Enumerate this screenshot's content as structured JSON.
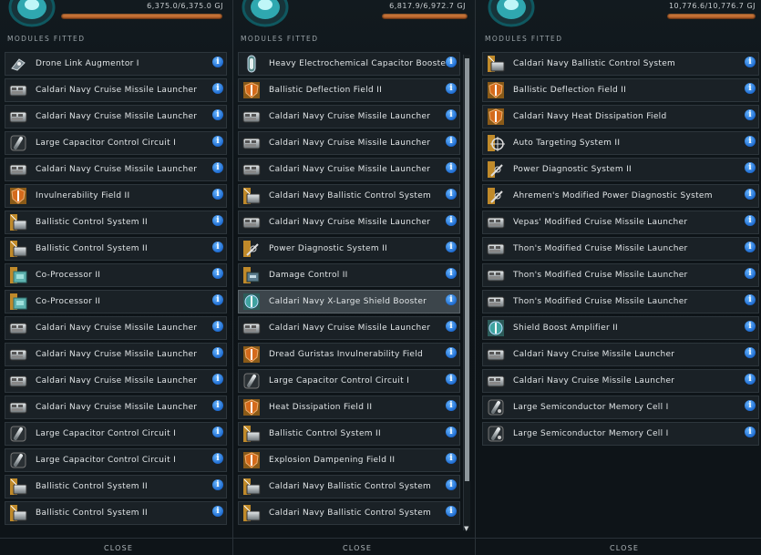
{
  "icons": {
    "drone-link-augmentor": "drone-link-icon",
    "cruise-launcher": "cruise-missile-launcher-icon",
    "cap-circuit": "capacitor-circuit-icon",
    "shield-field": "shield-hardener-icon",
    "ballistic": "ballistic-control-icon",
    "coprocessor": "co-processor-icon",
    "cap-booster": "capacitor-booster-icon",
    "shield-booster": "shield-booster-icon",
    "power-diag": "power-diagnostic-icon",
    "targeting": "targeting-system-icon",
    "damage-control": "damage-control-icon",
    "memory-cell": "memory-cell-icon",
    "info": "info-icon"
  },
  "colors": {
    "accent_bar": "#e38a46",
    "info": "#2a7be0",
    "selected_row": "#3c454b"
  },
  "panels": [
    {
      "energy": "6,375.0/6,375.0  GJ",
      "energy_fraction": 1.0,
      "header": "MODULES FITTED",
      "close": "CLOSE",
      "modules": [
        {
          "label": "Drone Link Augmentor I",
          "icon": "drone-link-augmentor"
        },
        {
          "label": "Caldari Navy Cruise Missile Launcher",
          "icon": "cruise-launcher"
        },
        {
          "label": "Caldari Navy Cruise Missile Launcher",
          "icon": "cruise-launcher"
        },
        {
          "label": "Large Capacitor Control Circuit I",
          "icon": "cap-circuit"
        },
        {
          "label": "Caldari Navy Cruise Missile Launcher",
          "icon": "cruise-launcher"
        },
        {
          "label": "Invulnerability Field II",
          "icon": "shield-field"
        },
        {
          "label": "Ballistic Control System II",
          "icon": "ballistic"
        },
        {
          "label": "Ballistic Control System II",
          "icon": "ballistic"
        },
        {
          "label": "Co-Processor II",
          "icon": "coprocessor"
        },
        {
          "label": "Co-Processor II",
          "icon": "coprocessor"
        },
        {
          "label": "Caldari Navy Cruise Missile Launcher",
          "icon": "cruise-launcher"
        },
        {
          "label": "Caldari Navy Cruise Missile Launcher",
          "icon": "cruise-launcher"
        },
        {
          "label": "Caldari Navy Cruise Missile Launcher",
          "icon": "cruise-launcher"
        },
        {
          "label": "Caldari Navy Cruise Missile Launcher",
          "icon": "cruise-launcher"
        },
        {
          "label": "Large Capacitor Control Circuit I",
          "icon": "cap-circuit"
        },
        {
          "label": "Large Capacitor Control Circuit I",
          "icon": "cap-circuit"
        },
        {
          "label": "Ballistic Control System II",
          "icon": "ballistic"
        },
        {
          "label": "Ballistic Control System II",
          "icon": "ballistic"
        }
      ]
    },
    {
      "energy": "6,817.9/6,972.7  GJ",
      "energy_fraction": 0.978,
      "header": "MODULES FITTED",
      "close": "CLOSE",
      "modules": [
        {
          "label": "Heavy Electrochemical Capacitor Booster I",
          "icon": "cap-booster"
        },
        {
          "label": "Ballistic Deflection Field II",
          "icon": "shield-field"
        },
        {
          "label": "Caldari Navy Cruise Missile Launcher",
          "icon": "cruise-launcher"
        },
        {
          "label": "Caldari Navy Cruise Missile Launcher",
          "icon": "cruise-launcher"
        },
        {
          "label": "Caldari Navy Cruise Missile Launcher",
          "icon": "cruise-launcher"
        },
        {
          "label": "Caldari Navy Ballistic Control System",
          "icon": "ballistic"
        },
        {
          "label": "Caldari Navy Cruise Missile Launcher",
          "icon": "cruise-launcher"
        },
        {
          "label": "Power Diagnostic System II",
          "icon": "power-diag"
        },
        {
          "label": "Damage Control II",
          "icon": "damage-control"
        },
        {
          "label": "Caldari Navy X-Large Shield Booster",
          "icon": "shield-booster",
          "selected": true
        },
        {
          "label": "Caldari Navy Cruise Missile Launcher",
          "icon": "cruise-launcher"
        },
        {
          "label": "Dread Guristas Invulnerability Field",
          "icon": "shield-field"
        },
        {
          "label": "Large Capacitor Control Circuit I",
          "icon": "cap-circuit"
        },
        {
          "label": "Heat Dissipation Field II",
          "icon": "shield-field"
        },
        {
          "label": "Ballistic Control System II",
          "icon": "ballistic"
        },
        {
          "label": "Explosion Dampening Field II",
          "icon": "shield-field"
        },
        {
          "label": "Caldari Navy Ballistic Control System",
          "icon": "ballistic"
        },
        {
          "label": "Caldari Navy Ballistic Control System",
          "icon": "ballistic"
        }
      ]
    },
    {
      "energy": "10,776.6/10,776.7  GJ",
      "energy_fraction": 1.0,
      "header": "MODULES FITTED",
      "close": "CLOSE",
      "modules": [
        {
          "label": "Caldari Navy Ballistic Control System",
          "icon": "ballistic"
        },
        {
          "label": "Ballistic Deflection Field II",
          "icon": "shield-field"
        },
        {
          "label": "Caldari Navy Heat Dissipation Field",
          "icon": "shield-field"
        },
        {
          "label": "Auto Targeting System II",
          "icon": "targeting"
        },
        {
          "label": "Power Diagnostic System II",
          "icon": "power-diag"
        },
        {
          "label": "Ahremen's Modified Power Diagnostic System",
          "icon": "power-diag"
        },
        {
          "label": "Vepas' Modified Cruise Missile Launcher",
          "icon": "cruise-launcher"
        },
        {
          "label": "Thon's Modified Cruise Missile Launcher",
          "icon": "cruise-launcher"
        },
        {
          "label": "Thon's Modified Cruise Missile Launcher",
          "icon": "cruise-launcher"
        },
        {
          "label": "Thon's Modified Cruise Missile Launcher",
          "icon": "cruise-launcher"
        },
        {
          "label": "Shield Boost Amplifier II",
          "icon": "shield-booster"
        },
        {
          "label": "Caldari Navy Cruise Missile Launcher",
          "icon": "cruise-launcher"
        },
        {
          "label": "Caldari Navy Cruise Missile Launcher",
          "icon": "cruise-launcher"
        },
        {
          "label": "Large Semiconductor Memory Cell I",
          "icon": "memory-cell"
        },
        {
          "label": "Large Semiconductor Memory Cell I",
          "icon": "memory-cell"
        }
      ]
    }
  ]
}
